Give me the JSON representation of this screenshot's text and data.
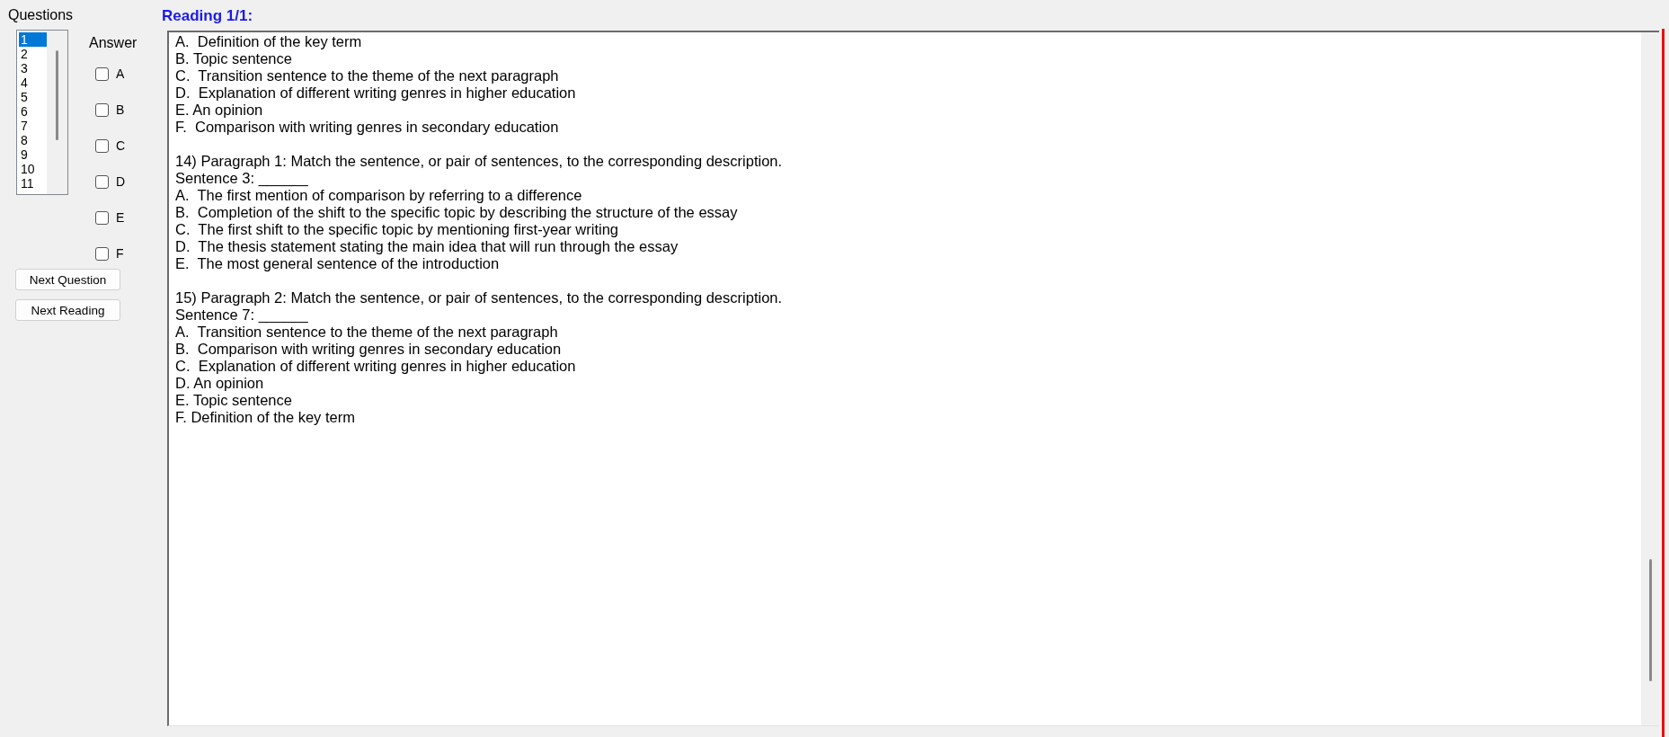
{
  "questions_panel": {
    "label": "Questions",
    "items": [
      {
        "label": "1",
        "selected": true
      },
      {
        "label": "2",
        "selected": false
      },
      {
        "label": "3",
        "selected": false
      },
      {
        "label": "4",
        "selected": false
      },
      {
        "label": "5",
        "selected": false
      },
      {
        "label": "6",
        "selected": false
      },
      {
        "label": "7",
        "selected": false
      },
      {
        "label": "8",
        "selected": false
      },
      {
        "label": "9",
        "selected": false
      },
      {
        "label": "10",
        "selected": false
      },
      {
        "label": "11",
        "selected": false
      }
    ]
  },
  "answer_panel": {
    "label": "Answer",
    "options": [
      {
        "label": "A",
        "checked": false
      },
      {
        "label": "B",
        "checked": false
      },
      {
        "label": "C",
        "checked": false
      },
      {
        "label": "D",
        "checked": false
      },
      {
        "label": "E",
        "checked": false
      },
      {
        "label": "F",
        "checked": false
      }
    ]
  },
  "buttons": [
    {
      "label": "Next Question"
    },
    {
      "label": "Next Reading"
    }
  ],
  "reading": {
    "title": "Reading 1/1:",
    "blocks": [
      {
        "lines": [
          "A.  Definition of the key term",
          "B. Topic sentence",
          "C.  Transition sentence to the theme of the next paragraph",
          "D.  Explanation of different writing genres in higher education",
          "E. An opinion",
          "F.  Comparison with writing genres in secondary education"
        ]
      },
      {
        "lines": [
          "14) Paragraph 1: Match the sentence, or pair of sentences, to the corresponding description.",
          "Sentence 3: ______",
          "A.  The first mention of comparison by referring to a difference",
          "B.  Completion of the shift to the specific topic by describing the structure of the essay",
          "C.  The first shift to the specific topic by mentioning first-year writing",
          "D.  The thesis statement stating the main idea that will run through the essay",
          "E.  The most general sentence of the introduction"
        ]
      },
      {
        "lines": [
          "15) Paragraph 2: Match the sentence, or pair of sentences, to the corresponding description.",
          "Sentence 7: ______",
          "A.  Transition sentence to the theme of the next paragraph",
          "B.  Comparison with writing genres in secondary education",
          "C.  Explanation of different writing genres in higher education",
          "D. An opinion",
          "E. Topic sentence",
          "F. Definition of the key term"
        ]
      }
    ]
  }
}
